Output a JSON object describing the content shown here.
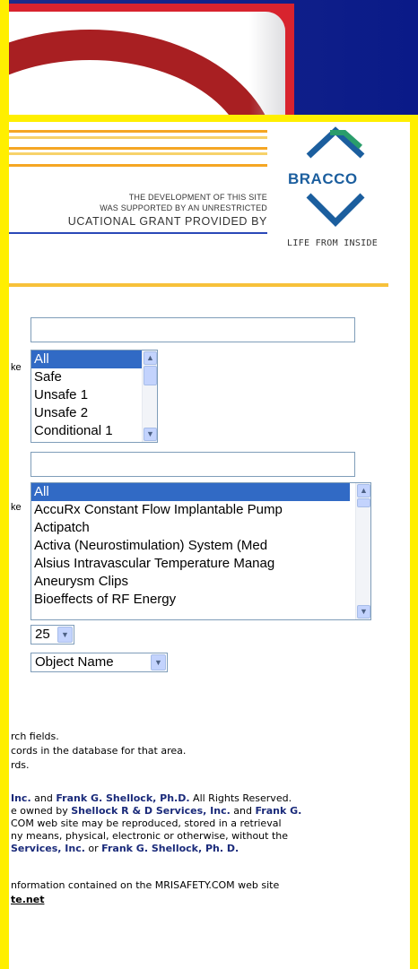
{
  "header": {
    "grant_line1": "THE DEVELOPMENT OF THIS SITE",
    "grant_line2": "WAS SUPPORTED BY AN UNRESTRICTED",
    "grant_line3": "UCATIONAL GRANT PROVIDED BY",
    "logo_name": "BRACCO",
    "logo_tagline": "LIFE FROM INSIDE"
  },
  "form": {
    "safety_label_fragment": "ke",
    "safety_options": [
      "All",
      "Safe",
      "Unsafe 1",
      "Unsafe 2",
      "Conditional 1"
    ],
    "safety_selected": "All",
    "object_label_fragment": "ke",
    "object_options": [
      "All",
      "AccuRx Constant Flow Implantable Pump",
      "Actipatch",
      "Activa (Neurostimulation) System (Med",
      "Alsius Intravascular Temperature Manag",
      "Aneurysm Clips",
      "Bioeffects of RF Energy"
    ],
    "object_selected": "All",
    "per_page_value": "25",
    "sort_value": "Object Name"
  },
  "notes": {
    "line1": "rch fields.",
    "line2": "cords in the database for that area.",
    "line3": "rds."
  },
  "copyright": {
    "l1_a": "Inc.",
    "l1_b": " and ",
    "l1_c": "Frank G. Shellock, Ph.D.",
    "l1_d": " All Rights Reserved.",
    "l2_a": "e owned by ",
    "l2_b": "Shellock R & D Services, Inc.",
    "l2_c": " and ",
    "l2_d": "Frank G.",
    "l3": "COM web site may be reproduced, stored in a retrieval",
    "l4": "ny means, physical, electronic or otherwise, without the",
    "l5_a": "Services, Inc.",
    "l5_b": " or ",
    "l5_c": "Frank G. Shellock, Ph. D."
  },
  "info": {
    "line1": "nformation contained on the MRISAFETY.COM web site",
    "link": "te.net"
  }
}
